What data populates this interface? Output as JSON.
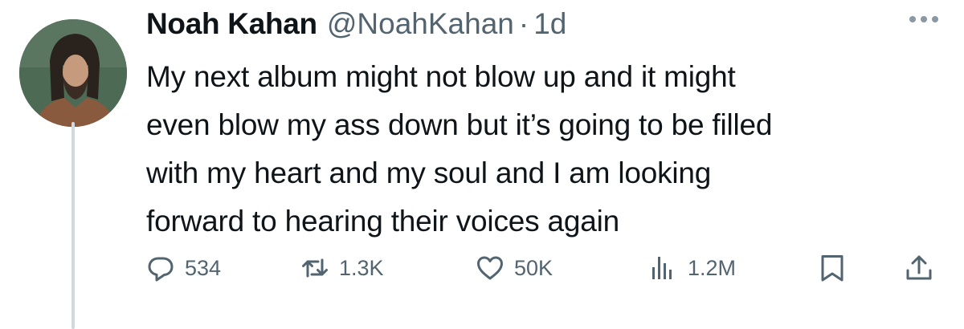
{
  "author": {
    "name": "Noah Kahan",
    "handle": "@NoahKahan",
    "separator": "·",
    "time": "1d"
  },
  "tweet": {
    "lines": [
      "My next album might not blow up and it might",
      "even blow my ass down but it’s going to be filled",
      "with my heart and my soul and I am looking",
      "forward to hearing their voices again"
    ]
  },
  "actions": {
    "replies": "534",
    "retweets": "1.3K",
    "likes": "50K",
    "views": "1.2M"
  },
  "icons": [
    "reply-icon",
    "retweet-icon",
    "heart-icon",
    "views-icon",
    "bookmark-icon",
    "share-icon",
    "more-icon"
  ],
  "colors": {
    "text": "#0f1419",
    "secondary": "#536471",
    "thread_line": "#cfd9de"
  }
}
